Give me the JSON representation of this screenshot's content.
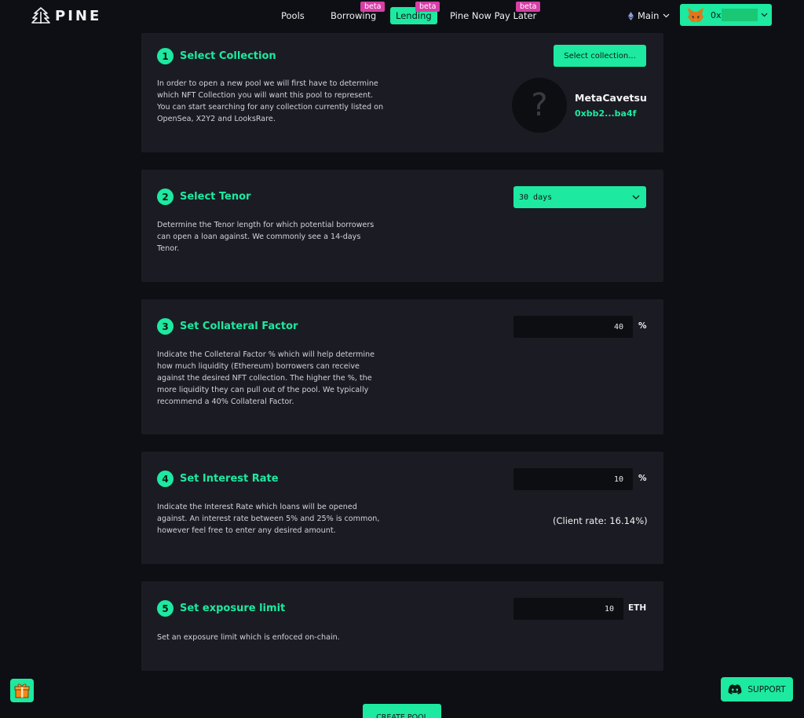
{
  "brand": {
    "name": "PINE"
  },
  "nav": {
    "items": [
      {
        "label": "Pools",
        "badge": ""
      },
      {
        "label": "Borrowing",
        "badge": "beta"
      },
      {
        "label": "Lending",
        "badge": "beta"
      },
      {
        "label": "Pine Now Pay Later",
        "badge": "beta"
      }
    ],
    "network": "Main",
    "wallet_prefix": "0x"
  },
  "steps": [
    {
      "number": "1",
      "title": "Select Collection",
      "description": "In order to open a new pool we will first have to determine which NFT Collection you will want this pool to represent. You can start searching for any collection currently listed on OpenSea, X2Y2 and LooksRare.",
      "button": "Select collection...",
      "collection": {
        "placeholder_glyph": "?",
        "name": "MetaCavetsu",
        "address": "0xbb2...ba4f"
      }
    },
    {
      "number": "2",
      "title": "Select Tenor",
      "description": "Determine the Tenor length for which potential borrowers can open a loan against. We commonly see a 14-days Tenor.",
      "select_value": "30 days"
    },
    {
      "number": "3",
      "title": "Set Collateral Factor",
      "description": "Indicate the Colleteral Factor % which will help determine how much liquidity (Ethereum) borrowers can receive against the desired NFT collection. The higher the %, the more liquidity they can pull out of the pool. We typically recommend a 40% Collateral Factor.",
      "value": "40",
      "unit": "%"
    },
    {
      "number": "4",
      "title": "Set Interest Rate",
      "description": "Indicate the Interest Rate which loans will be opened against. An interest rate between 5% and 25% is common, however feel free to enter any desired amount.",
      "value": "10",
      "unit": "%",
      "client_rate": "(Client rate: 16.14%)"
    },
    {
      "number": "5",
      "title": "Set exposure limit",
      "description": "Set an exposure limit which is enfoced on-chain.",
      "value": "10",
      "unit": "ETH"
    }
  ],
  "support_label": "SUPPORT",
  "create_label": "CREATE POOL",
  "colors": {
    "accent": "#1de9a0",
    "background": "#0e0f14",
    "card": "#1b1c23",
    "badge": "#d63fa7"
  }
}
